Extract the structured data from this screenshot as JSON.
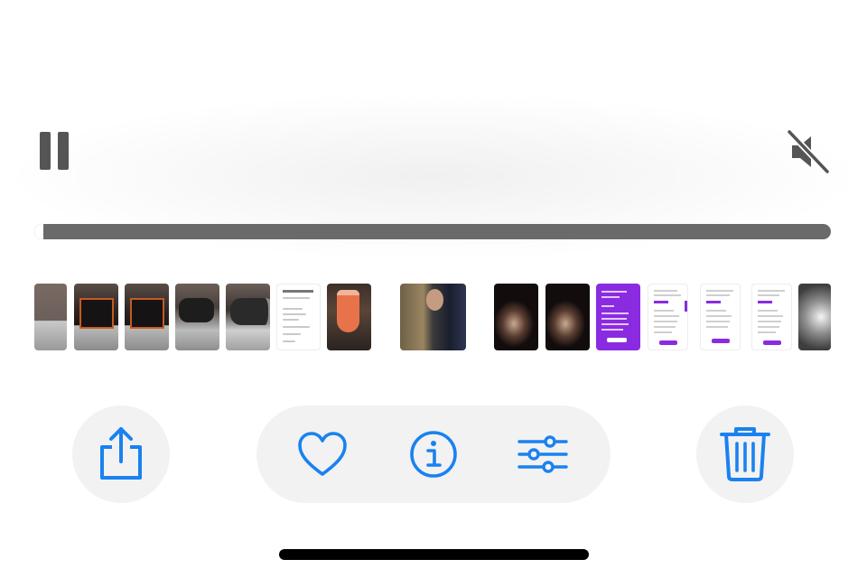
{
  "player": {
    "pause_icon": "pause-icon",
    "mute_icon": "speaker-muted-icon",
    "progress": 0.0
  },
  "filmstrip": {
    "items": [
      "camera-box-thumbnail",
      "camera-box-thumbnail",
      "camera-box-thumbnail",
      "lens-thumbnail",
      "lens-thumbnail",
      "receipt-screenshot-thumbnail",
      "cup-thumbnail",
      "wedding-kiss-thumbnail",
      "night-party-thumbnail",
      "night-party-thumbnail",
      "purple-app-screenshot-thumbnail",
      "app-screenshot-thumbnail",
      "app-screenshot-thumbnail",
      "app-screenshot-thumbnail",
      "image-thumbnail"
    ]
  },
  "toolbar": {
    "share_icon": "share-icon",
    "favorite_icon": "heart-icon",
    "info_icon": "info-icon",
    "adjust_icon": "sliders-icon",
    "delete_icon": "trash-icon"
  },
  "colors": {
    "accent": "#1a82f0",
    "button_bg": "#f2f2f2",
    "progress_track": "#6a6a6a",
    "control_gray": "#555555"
  }
}
